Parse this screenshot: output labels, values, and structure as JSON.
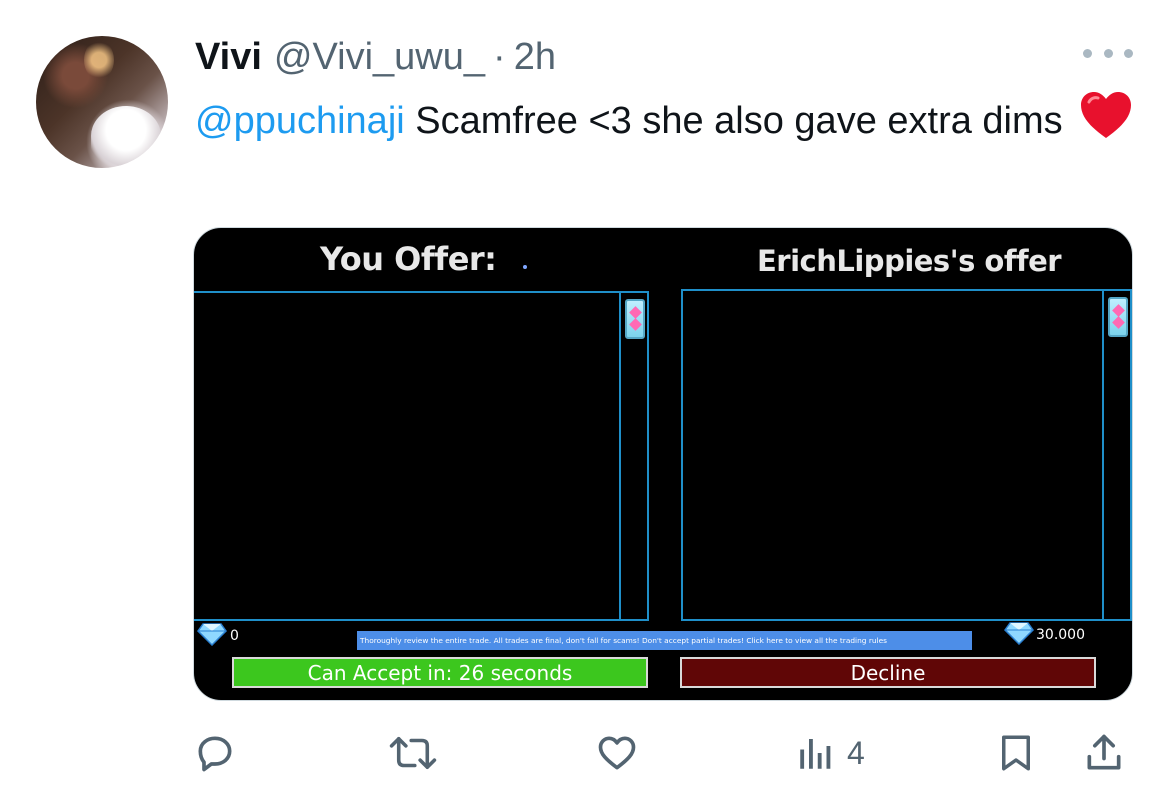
{
  "tweet": {
    "display_name": "Vivi",
    "handle": "@Vivi_uwu_",
    "separator": "·",
    "time": "2h",
    "mention": "@ppuchinaji",
    "text": "Scamfree <3 she also gave extra dims",
    "emoji": "heart-emoji"
  },
  "game": {
    "you_offer_title": "You Offer:",
    "their_offer_title": "ErichLippies's offer",
    "your_gems": "0",
    "their_gems": "30.000",
    "notice": "Thoroughly review the entire trade. All trades are final, don't fall for scams! Don't accept partial trades! Click here to view all the trading rules",
    "accept_label": "Can Accept in: 26 seconds",
    "decline_label": "Decline",
    "colors": {
      "accept": "#3cc71e",
      "decline": "#600606",
      "border": "#1f8fc9",
      "notice": "#4d8ee8"
    }
  },
  "actions": {
    "views_count": "4",
    "icons": [
      "reply-icon",
      "retweet-icon",
      "like-icon",
      "views-icon",
      "bookmark-icon",
      "share-icon"
    ]
  }
}
